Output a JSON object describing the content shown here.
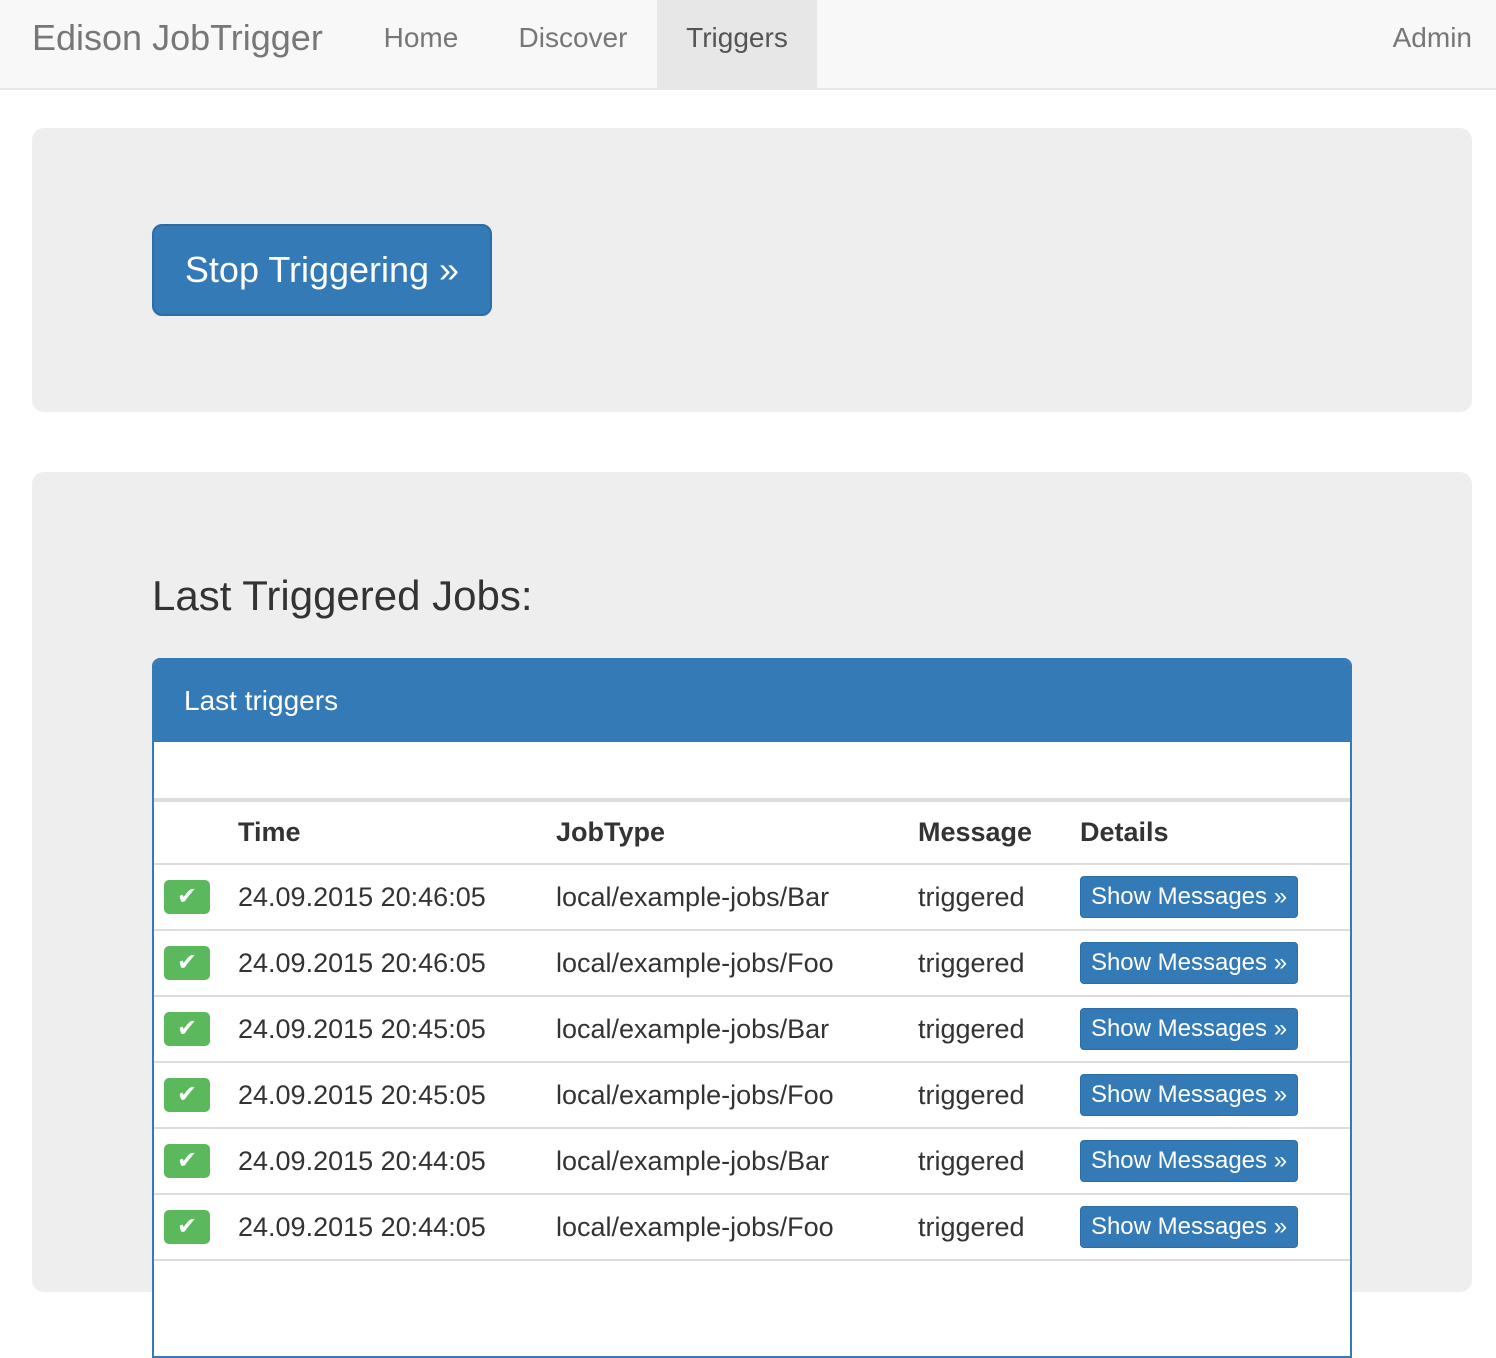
{
  "navbar": {
    "brand": "Edison JobTrigger",
    "items": [
      {
        "label": "Home",
        "active": false
      },
      {
        "label": "Discover",
        "active": false
      },
      {
        "label": "Triggers",
        "active": true
      }
    ],
    "right_item": "Admin"
  },
  "controls": {
    "stop_button_label": "Stop Triggering »"
  },
  "last_jobs": {
    "title": "Last Triggered Jobs:",
    "panel_heading": "Last triggers",
    "columns": [
      "",
      "Time",
      "JobType",
      "Message",
      "Details"
    ],
    "status_icon": "check-icon",
    "status_glyph": "✔",
    "status_color": "#5cb85c",
    "details_button_label": "Show Messages »",
    "rows": [
      {
        "time": "24.09.2015 20:46:05",
        "job_type": "local/example-jobs/Bar",
        "message": "triggered"
      },
      {
        "time": "24.09.2015 20:46:05",
        "job_type": "local/example-jobs/Foo",
        "message": "triggered"
      },
      {
        "time": "24.09.2015 20:45:05",
        "job_type": "local/example-jobs/Bar",
        "message": "triggered"
      },
      {
        "time": "24.09.2015 20:45:05",
        "job_type": "local/example-jobs/Foo",
        "message": "triggered"
      },
      {
        "time": "24.09.2015 20:44:05",
        "job_type": "local/example-jobs/Bar",
        "message": "triggered"
      },
      {
        "time": "24.09.2015 20:44:05",
        "job_type": "local/example-jobs/Foo",
        "message": "triggered"
      }
    ]
  },
  "colors": {
    "primary": "#337ab7",
    "success": "#5cb85c",
    "jumbotron": "#eeeeee",
    "navbar": "#f8f8f8"
  }
}
